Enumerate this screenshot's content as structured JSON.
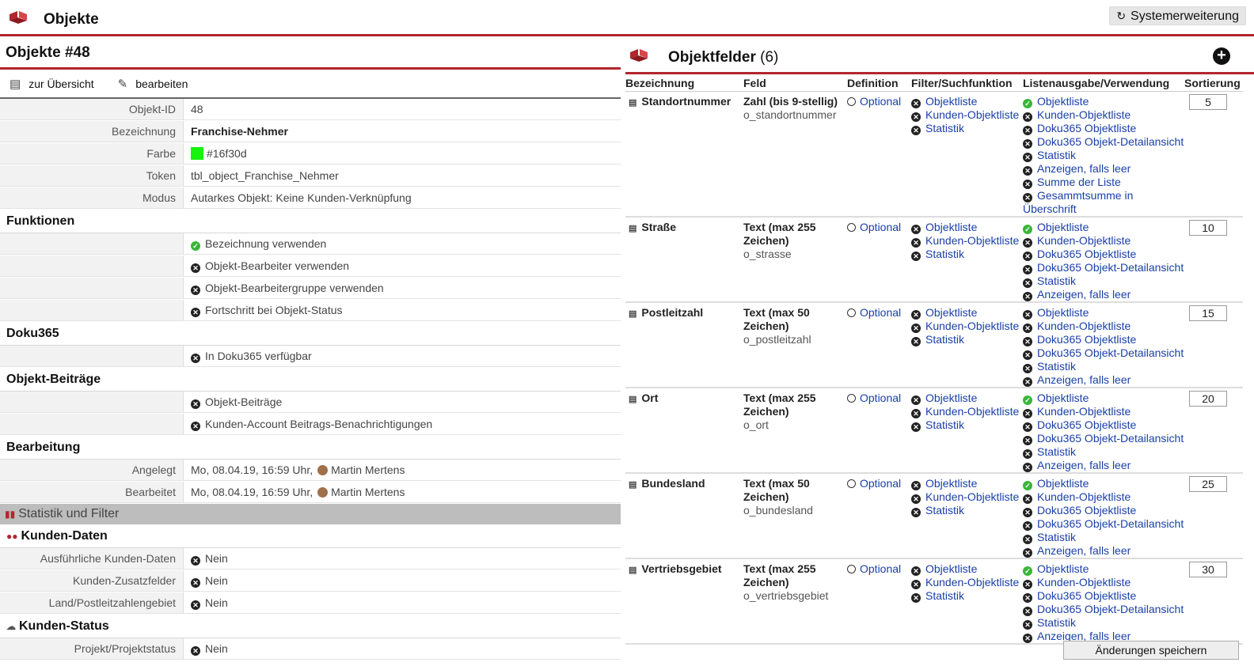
{
  "app": {
    "title": "Objekte",
    "system_button": "Systemerweiterung"
  },
  "detail": {
    "heading": "Objekte #48",
    "actions": {
      "overview": "zur Übersicht",
      "edit": "bearbeiten"
    },
    "fields": [
      {
        "label": "Objekt-ID",
        "value": "48"
      },
      {
        "label": "Bezeichnung",
        "value": "Franchise-Nehmer"
      },
      {
        "label": "Farbe",
        "value": "#16f30d"
      },
      {
        "label": "Token",
        "value": "tbl_object_Franchise_Nehmer"
      },
      {
        "label": "Modus",
        "value": "Autarkes Objekt: Keine Kunden-Verknüpfung"
      }
    ],
    "sections": {
      "funktionen": "Funktionen",
      "doku": "Doku365",
      "beitraege": "Objekt-Beiträge",
      "bearbeitung": "Bearbeitung",
      "statistik": "Statistik und Filter",
      "kunden_daten": "Kunden-Daten",
      "kunden_status": "Kunden-Status"
    },
    "funktionen": [
      {
        "label": "Bezeichnung verwenden",
        "on": true
      },
      {
        "label": "Objekt-Bearbeiter verwenden",
        "on": false
      },
      {
        "label": "Objekt-Bearbeitergruppe verwenden",
        "on": false
      },
      {
        "label": "Fortschritt bei Objekt-Status",
        "on": false
      }
    ],
    "doku": [
      {
        "label": "In Doku365 verfügbar",
        "on": false
      }
    ],
    "beitraege": [
      {
        "label": "Objekt-Beiträge",
        "on": false
      },
      {
        "label": "Kunden-Account Beitrags-Benachrichtigungen",
        "on": false
      }
    ],
    "bearbeitung": [
      {
        "label": "Angelegt",
        "date": "Mo, 08.04.19, 16:59 Uhr,",
        "user": "Martin Mertens"
      },
      {
        "label": "Bearbeitet",
        "date": "Mo, 08.04.19, 16:59 Uhr,",
        "user": "Martin Mertens"
      }
    ],
    "kunden_daten": [
      {
        "label": "Ausführliche Kunden-Daten",
        "value": "Nein"
      },
      {
        "label": "Kunden-Zusatzfelder",
        "value": "Nein"
      },
      {
        "label": "Land/Postleitzahlengebiet",
        "value": "Nein"
      }
    ],
    "kunden_status": [
      {
        "label": "Projekt/Projektstatus",
        "value": "Nein"
      }
    ]
  },
  "objektfelder": {
    "title": "Objektfelder",
    "count": "(6)",
    "columns": [
      "Bezeichnung",
      "Feld",
      "Definition",
      "Filter/Suchfunktion",
      "Listenausgabe/Verwendung",
      "Sortierung"
    ],
    "save_label": "Änderungen speichern",
    "rows": [
      {
        "name": "Standortnummer",
        "type": "Zahl (bis 9-stellig)",
        "column": "o_standortnummer",
        "definition": "Optional",
        "filter": [
          "Objektliste",
          "Kunden-Objektliste",
          "Statistik"
        ],
        "list": [
          {
            "t": "Objektliste",
            "on": true
          },
          {
            "t": "Kunden-Objektliste",
            "on": false
          },
          {
            "t": "Doku365 Objektliste",
            "on": false
          },
          {
            "t": "Doku365 Objekt-Detailansicht",
            "on": false
          },
          {
            "t": "Statistik",
            "on": false
          },
          {
            "t": "Anzeigen, falls leer",
            "on": false
          },
          {
            "t": "Summe der Liste",
            "on": false
          },
          {
            "t": "Gesammtsumme in Überschrift",
            "on": false
          }
        ],
        "sort": "5"
      },
      {
        "name": "Straße",
        "type": "Text (max 255 Zeichen)",
        "column": "o_strasse",
        "definition": "Optional",
        "filter": [
          "Objektliste",
          "Kunden-Objektliste",
          "Statistik"
        ],
        "list": [
          {
            "t": "Objektliste",
            "on": true
          },
          {
            "t": "Kunden-Objektliste",
            "on": false
          },
          {
            "t": "Doku365 Objektliste",
            "on": false
          },
          {
            "t": "Doku365 Objekt-Detailansicht",
            "on": false
          },
          {
            "t": "Statistik",
            "on": false
          },
          {
            "t": "Anzeigen, falls leer",
            "on": false
          }
        ],
        "sort": "10"
      },
      {
        "name": "Postleitzahl",
        "type": "Text (max 50 Zeichen)",
        "column": "o_postleitzahl",
        "definition": "Optional",
        "filter": [
          "Objektliste",
          "Kunden-Objektliste",
          "Statistik"
        ],
        "list": [
          {
            "t": "Objektliste",
            "on": false
          },
          {
            "t": "Kunden-Objektliste",
            "on": false
          },
          {
            "t": "Doku365 Objektliste",
            "on": false
          },
          {
            "t": "Doku365 Objekt-Detailansicht",
            "on": false
          },
          {
            "t": "Statistik",
            "on": false
          },
          {
            "t": "Anzeigen, falls leer",
            "on": false
          }
        ],
        "sort": "15"
      },
      {
        "name": "Ort",
        "type": "Text (max 255 Zeichen)",
        "column": "o_ort",
        "definition": "Optional",
        "filter": [
          "Objektliste",
          "Kunden-Objektliste",
          "Statistik"
        ],
        "list": [
          {
            "t": "Objektliste",
            "on": true
          },
          {
            "t": "Kunden-Objektliste",
            "on": false
          },
          {
            "t": "Doku365 Objektliste",
            "on": false
          },
          {
            "t": "Doku365 Objekt-Detailansicht",
            "on": false
          },
          {
            "t": "Statistik",
            "on": false
          },
          {
            "t": "Anzeigen, falls leer",
            "on": false
          }
        ],
        "sort": "20"
      },
      {
        "name": "Bundesland",
        "type": "Text (max 50 Zeichen)",
        "column": "o_bundesland",
        "definition": "Optional",
        "filter": [
          "Objektliste",
          "Kunden-Objektliste",
          "Statistik"
        ],
        "list": [
          {
            "t": "Objektliste",
            "on": true
          },
          {
            "t": "Kunden-Objektliste",
            "on": false
          },
          {
            "t": "Doku365 Objektliste",
            "on": false
          },
          {
            "t": "Doku365 Objekt-Detailansicht",
            "on": false
          },
          {
            "t": "Statistik",
            "on": false
          },
          {
            "t": "Anzeigen, falls leer",
            "on": false
          }
        ],
        "sort": "25"
      },
      {
        "name": "Vertriebsgebiet",
        "type": "Text (max 255 Zeichen)",
        "column": "o_vertriebsgebiet",
        "definition": "Optional",
        "filter": [
          "Objektliste",
          "Kunden-Objektliste",
          "Statistik"
        ],
        "list": [
          {
            "t": "Objektliste",
            "on": true
          },
          {
            "t": "Kunden-Objektliste",
            "on": false
          },
          {
            "t": "Doku365 Objektliste",
            "on": false
          },
          {
            "t": "Doku365 Objekt-Detailansicht",
            "on": false
          },
          {
            "t": "Statistik",
            "on": false
          },
          {
            "t": "Anzeigen, falls leer",
            "on": false
          }
        ],
        "sort": "30"
      }
    ]
  }
}
